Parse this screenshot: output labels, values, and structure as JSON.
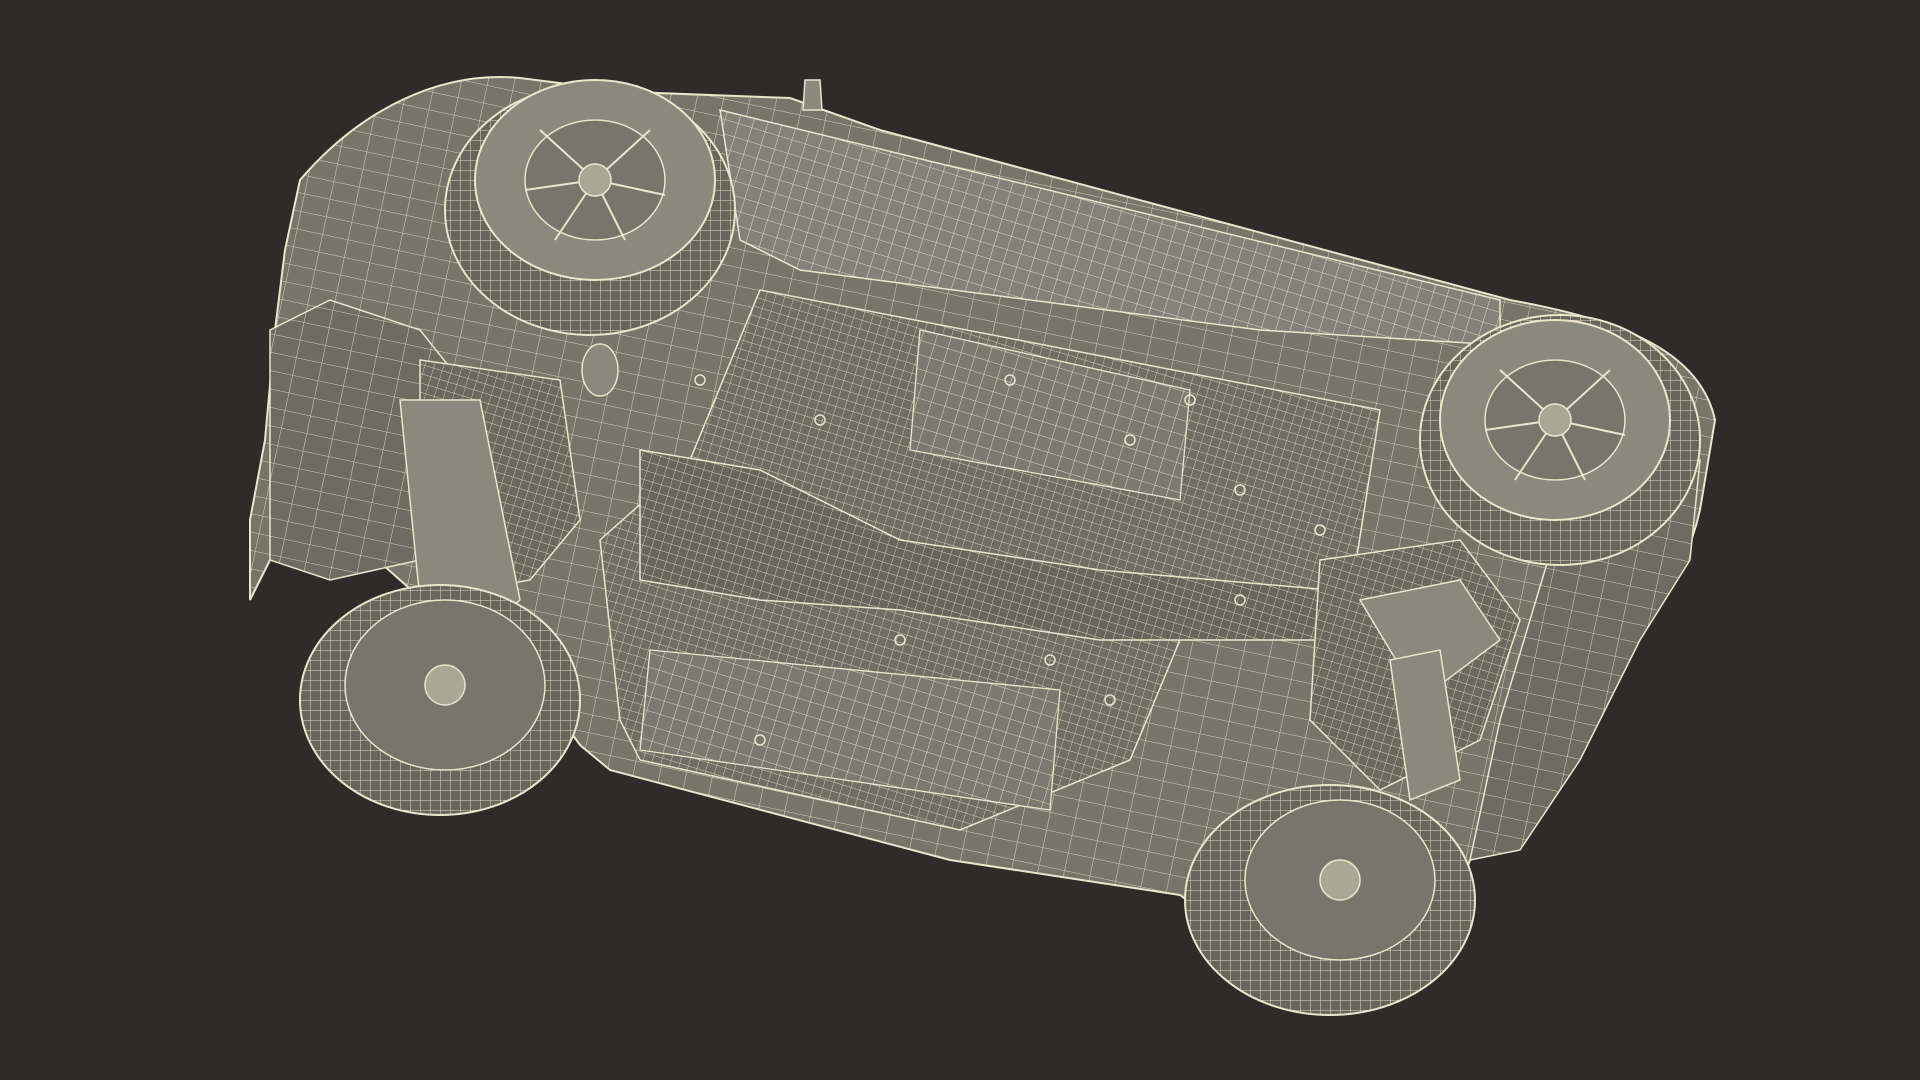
{
  "scene": {
    "subject": "car-underside-wireframe",
    "colors": {
      "background": "#2d2c2b",
      "surface": "#76756a",
      "surface_dark": "#5f5e55",
      "surface_light": "#8a897d",
      "wire": "#e9e6c9",
      "wire_soft": "#d2cfb2"
    }
  }
}
